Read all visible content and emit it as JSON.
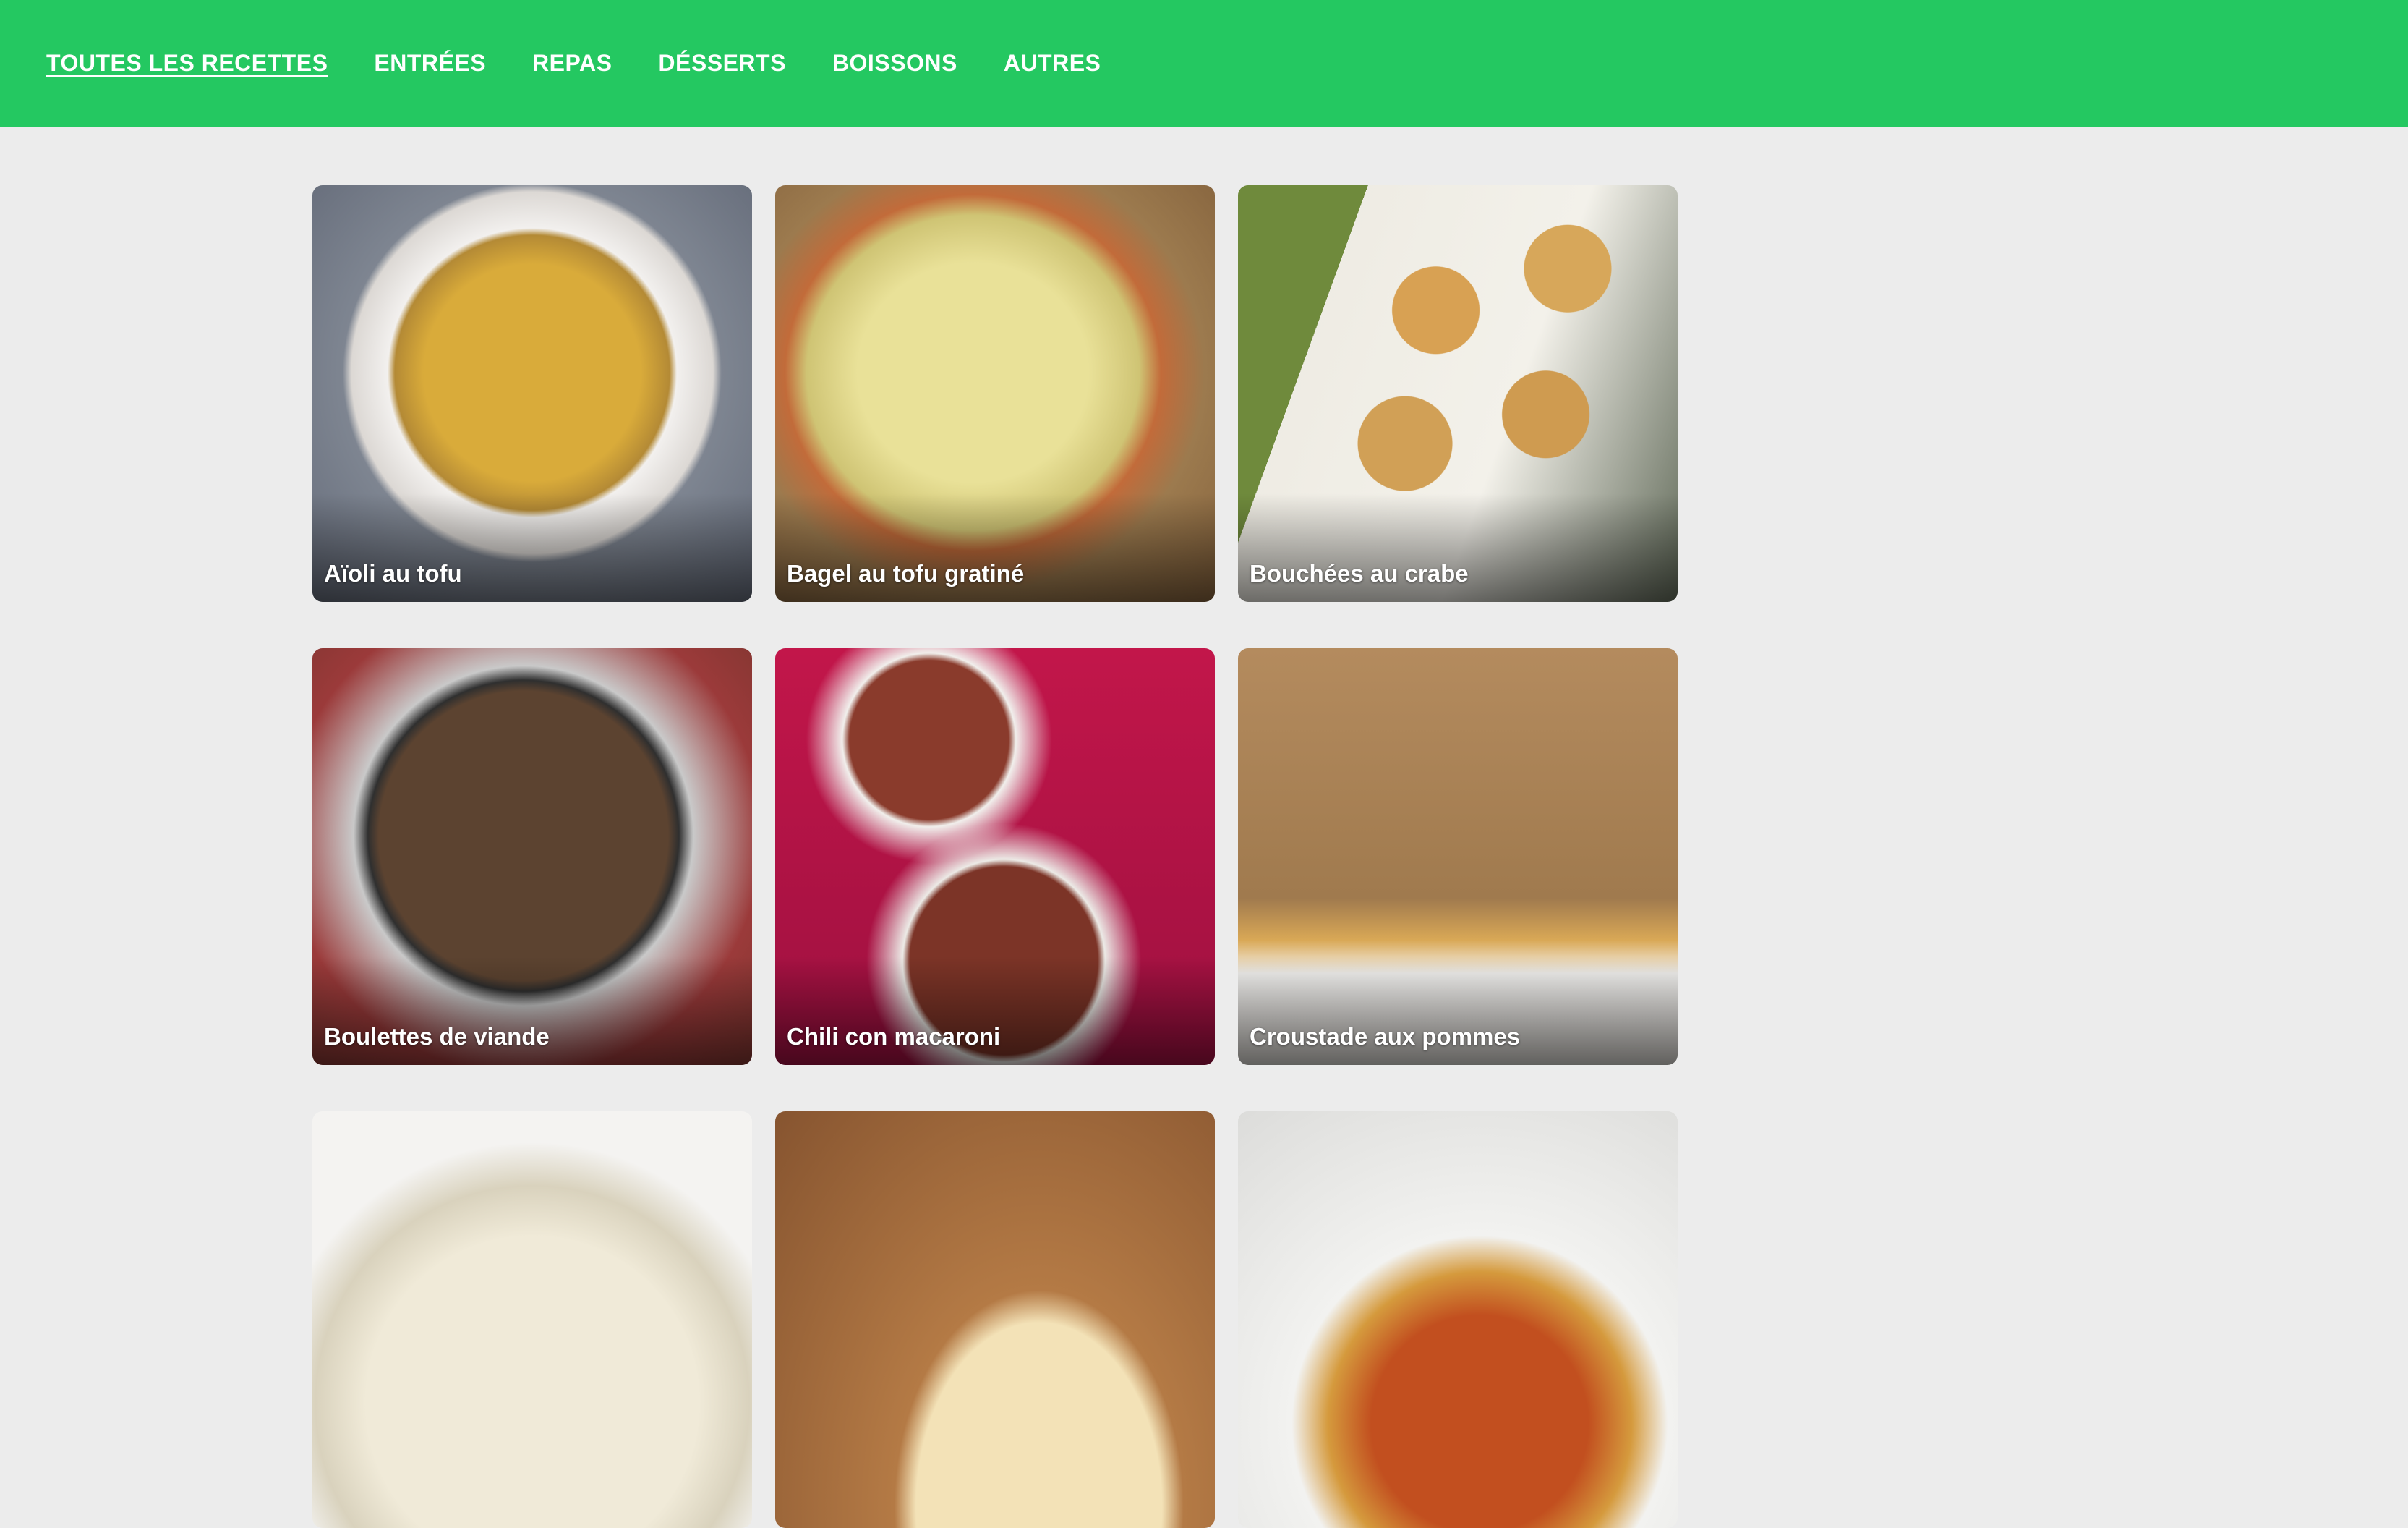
{
  "nav": {
    "items": [
      {
        "label": "TOUTES LES RECETTES",
        "active": true
      },
      {
        "label": "ENTRÉES",
        "active": false
      },
      {
        "label": "REPAS",
        "active": false
      },
      {
        "label": "DÉSSERTS",
        "active": false
      },
      {
        "label": "BOISSONS",
        "active": false
      },
      {
        "label": "AUTRES",
        "active": false
      }
    ]
  },
  "colors": {
    "nav_background": "#24c861",
    "page_background": "#ececec",
    "nav_text": "#ffffff"
  },
  "recipes": [
    {
      "title": "Aïoli au tofu"
    },
    {
      "title": "Bagel au tofu gratiné"
    },
    {
      "title": "Bouchées au crabe"
    },
    {
      "title": "Boulettes de viande"
    },
    {
      "title": "Chili con macaroni"
    },
    {
      "title": "Croustade aux pommes"
    },
    {
      "title": ""
    },
    {
      "title": ""
    },
    {
      "title": ""
    }
  ]
}
